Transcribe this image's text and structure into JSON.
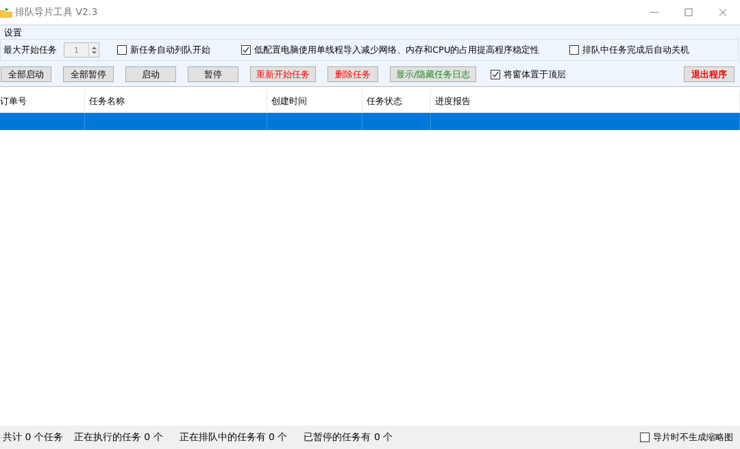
{
  "window": {
    "title": "排队导片工具 V2.3"
  },
  "settings": {
    "title": "设置",
    "max_label": "最大开始任务",
    "max_value": "1",
    "options": [
      {
        "label": "新任务自动列队开始",
        "checked": false
      },
      {
        "label": "低配置电脑使用单线程导入减少网络、内存和CPU的占用提高程序稳定性",
        "checked": true
      },
      {
        "label": "排队中任务完成后自动关机",
        "checked": false
      }
    ]
  },
  "buttons": [
    {
      "label": "全部启动"
    },
    {
      "label": "全部暂停"
    },
    {
      "label": "启动"
    },
    {
      "label": "暂停"
    },
    {
      "label": "重新开始任务",
      "color": "#ff0000"
    },
    {
      "label": "删除任务",
      "color": "#ff0000"
    },
    {
      "label": "显示/隐藏任务日志",
      "color": "#1a8a1a"
    }
  ],
  "topmost": {
    "label": "将窗体置于顶层",
    "checked": true
  },
  "exit_button": {
    "label": "退出程序"
  },
  "table": {
    "columns": [
      "订单号",
      "任务名称",
      "创建时间",
      "任务状态",
      "进度报告"
    ],
    "rows": [
      {
        "selected": true
      }
    ]
  },
  "status_bar": {
    "items": [
      "共计 0 个任务",
      "正在执行的任务 0 个",
      "正在排队中的任务有 0 个",
      "已暂停的任务有 0 个"
    ],
    "thumbnail_option": {
      "label": "导片时不生成缩略图",
      "checked": false
    }
  }
}
